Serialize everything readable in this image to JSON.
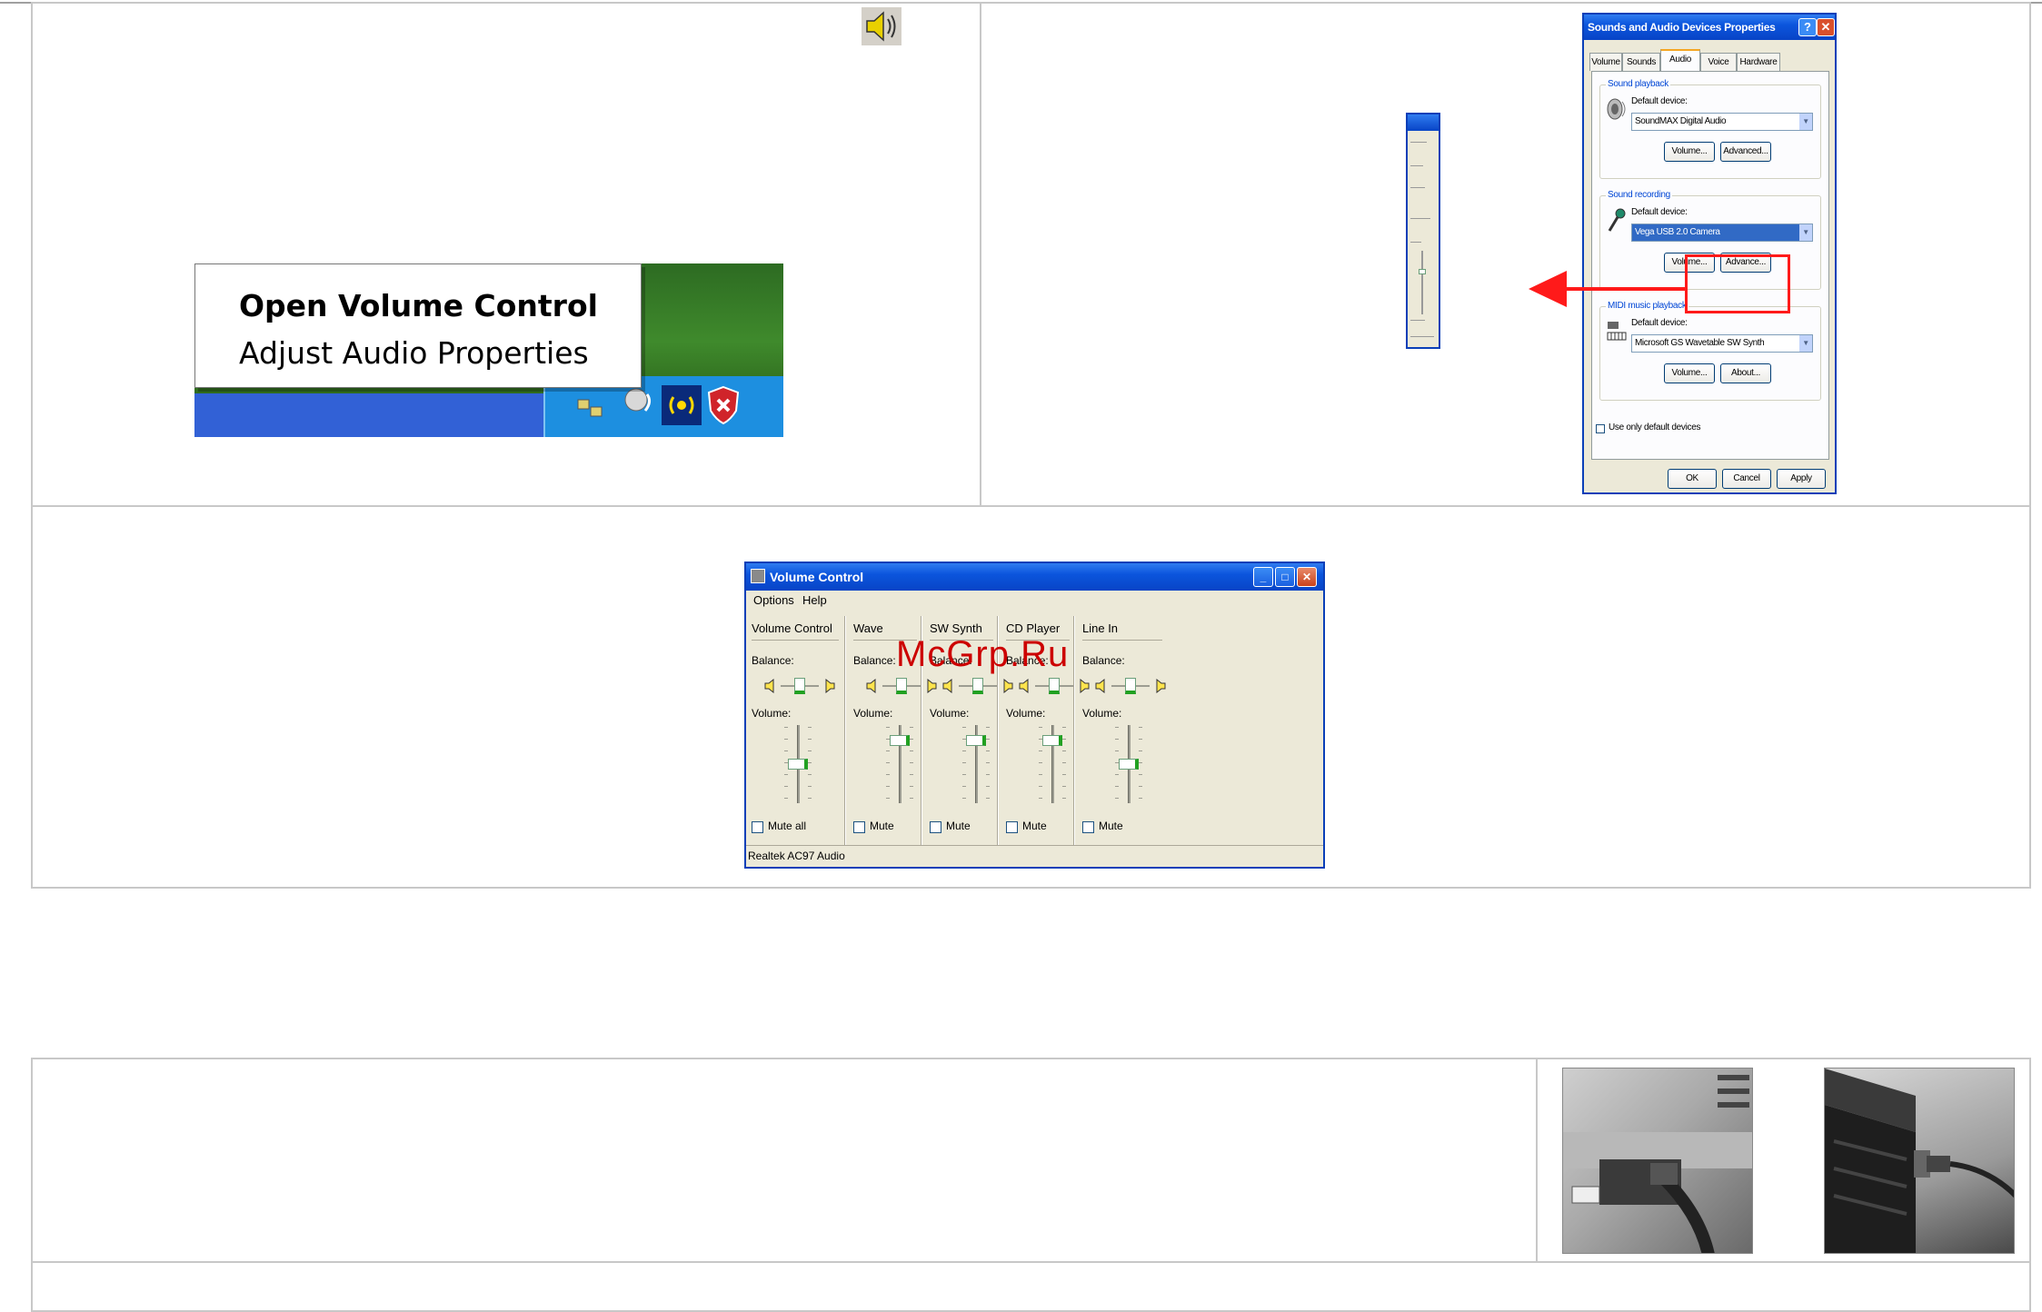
{
  "tray_menu": {
    "items": [
      "Open Volume Control",
      "Adjust Audio Properties"
    ]
  },
  "sound_properties": {
    "title": "Sounds and Audio Devices Properties",
    "tabs": [
      "Volume",
      "Sounds",
      "Audio",
      "Voice",
      "Hardware"
    ],
    "active_tab": "Audio",
    "sections": [
      {
        "label": "Sound playback",
        "default_device_label": "Default device:",
        "device": "SoundMAX Digital Audio",
        "buttons": [
          "Volume...",
          "Advanced..."
        ]
      },
      {
        "label": "Sound recording",
        "default_device_label": "Default device:",
        "device": "Vega USB 2.0 Camera",
        "buttons": [
          "Volume...",
          "Advance..."
        ]
      },
      {
        "label": "MIDI music playback",
        "default_device_label": "Default device:",
        "device": "Microsoft GS Wavetable SW Synth",
        "buttons": [
          "Volume...",
          "About..."
        ]
      }
    ],
    "use_only_default": "Use only default devices",
    "footer_buttons": [
      "OK",
      "Cancel",
      "Apply"
    ]
  },
  "volume_control": {
    "title": "Volume Control",
    "menu": [
      "Options",
      "Help"
    ],
    "balance_label": "Balance:",
    "volume_label": "Volume:",
    "channels": [
      {
        "name": "Volume Control",
        "mute": "Mute all",
        "balance": 0.5,
        "volume": 0.5
      },
      {
        "name": "Wave",
        "mute": "Mute",
        "balance": 0.5,
        "volume": 0.85
      },
      {
        "name": "SW Synth",
        "mute": "Mute",
        "balance": 0.5,
        "volume": 0.85
      },
      {
        "name": "CD Player",
        "mute": "Mute",
        "balance": 0.5,
        "volume": 0.85
      },
      {
        "name": "Line In",
        "mute": "Mute",
        "balance": 0.5,
        "volume": 0.5
      }
    ],
    "status": "Realtek AC97 Audio"
  },
  "watermark": "McGrp.Ru",
  "colors": {
    "xp_blue": "#0a3fb8",
    "highlight_red": "#ff1a1a",
    "dialog_bg": "#ece9d8"
  }
}
